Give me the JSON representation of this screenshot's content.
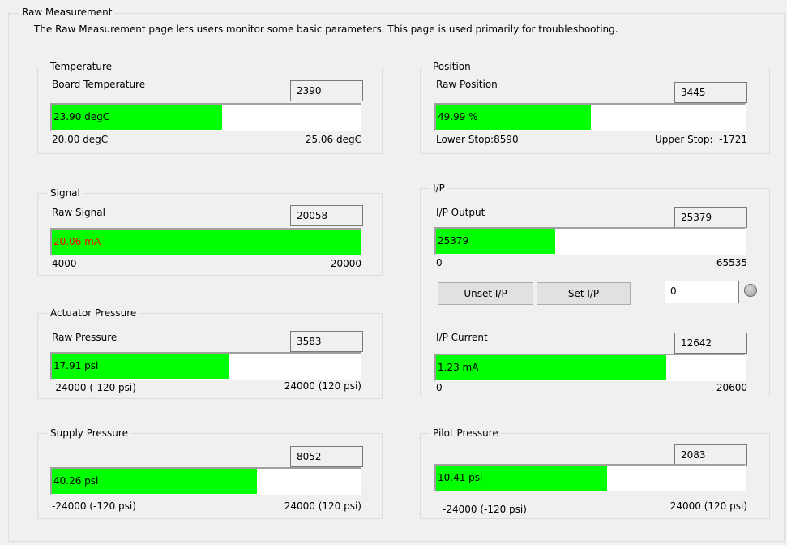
{
  "page": {
    "title": "Raw Measurement",
    "description": "The Raw Measurement page lets users monitor some basic parameters. This page is used primarily for troubleshooting."
  },
  "colors": {
    "bar_fill": "#00ff00",
    "signal_text": "#ff0000"
  },
  "temperature": {
    "title": "Temperature",
    "label": "Board Temperature",
    "raw": "2390",
    "bar_text": "23.90 degC",
    "fill_fraction": 0.55,
    "min": "20.00 degC",
    "max": "25.06 degC"
  },
  "position": {
    "title": "Position",
    "label": "Raw Position",
    "raw": "3445",
    "bar_text": "49.99 %",
    "fill_fraction": 0.5,
    "min": "Lower Stop:8590",
    "max": "Upper Stop:  -1721"
  },
  "signal": {
    "title": "Signal",
    "label": "Raw Signal",
    "raw": "20058",
    "bar_text": "20.06 mA",
    "fill_fraction": 1.0,
    "min": "4000",
    "max": "20000"
  },
  "ip": {
    "title": "I/P",
    "output": {
      "label": "I/P Output",
      "raw": "25379",
      "bar_text": "25379",
      "fill_fraction": 0.385,
      "min": "0",
      "max": "65535"
    },
    "unset_label": "Unset I/P",
    "set_label": "Set I/P",
    "input_value": "0",
    "current": {
      "label": "I/P Current",
      "raw": "12642",
      "bar_text": "1.23 mA",
      "fill_fraction": 0.745,
      "min": "0",
      "max": "20600"
    }
  },
  "actuator": {
    "title": "Actuator Pressure",
    "label": "Raw Pressure",
    "raw": "3583",
    "bar_text": "17.91 psi",
    "fill_fraction": 0.575,
    "min": "-24000 (-120 psi)",
    "max": "24000 (120 psi)"
  },
  "supply": {
    "title": "Supply Pressure",
    "raw": "8052",
    "bar_text": "40.26 psi",
    "fill_fraction": 0.665,
    "min": "-24000 (-120 psi)",
    "max": "24000 (120 psi)"
  },
  "pilot": {
    "title": "Pilot Pressure",
    "raw": "2083",
    "bar_text": "10.41 psi",
    "fill_fraction": 0.555,
    "min": "-24000 (-120 psi)",
    "max": "24000 (120 psi)"
  }
}
